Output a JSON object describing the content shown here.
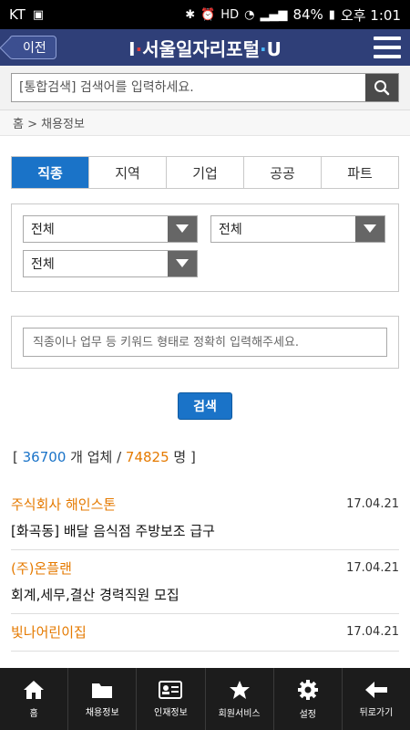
{
  "statusbar": {
    "carrier": "KT",
    "battery": "84%",
    "time": "오후 1:01"
  },
  "appbar": {
    "back_label": "이전",
    "title_prefix": "I",
    "title_main": "서울일자리포털",
    "title_suffix": "U",
    "menu_icon": "hamburger-icon"
  },
  "search": {
    "placeholder": "[통합검색] 검색어를 입력하세요.",
    "button_icon": "search-icon"
  },
  "breadcrumb": "홈 > 채용정보",
  "tabs": [
    {
      "label": "직종",
      "active": true
    },
    {
      "label": "지역",
      "active": false
    },
    {
      "label": "기업",
      "active": false
    },
    {
      "label": "공공",
      "active": false
    },
    {
      "label": "파트",
      "active": false
    }
  ],
  "filters": {
    "select1": "전체",
    "select2": "전체",
    "select3": "전체"
  },
  "keyword": {
    "placeholder": "직종이나 업무 등 키워드 형태로 정확히 입력해주세요."
  },
  "submit_label": "검색",
  "summary": {
    "open": "[",
    "companies": "36700",
    "companies_unit": "개 업체 /",
    "people": "74825",
    "people_unit": "명 ]"
  },
  "jobs": [
    {
      "company": "주식회사 해인스톤",
      "date": "17.04.21",
      "title": "[화곡동] 배달 음식점 주방보조 급구"
    },
    {
      "company": "(주)온플랜",
      "date": "17.04.21",
      "title": "회계,세무,결산 경력직원 모집"
    },
    {
      "company": "빛나어린이집",
      "date": "17.04.21",
      "title": ""
    }
  ],
  "bottomnav": [
    {
      "label": "홈",
      "icon": "home-icon"
    },
    {
      "label": "채용정보",
      "icon": "folder-icon"
    },
    {
      "label": "인재정보",
      "icon": "id-card-icon"
    },
    {
      "label": "회원서비스",
      "icon": "star-icon"
    },
    {
      "label": "설정",
      "icon": "gear-icon"
    },
    {
      "label": "뒤로가기",
      "icon": "back-arrow-icon"
    }
  ],
  "colors": {
    "appbar": "#2f3f78",
    "accent_blue": "#1a73c8",
    "accent_orange": "#e57a00"
  }
}
